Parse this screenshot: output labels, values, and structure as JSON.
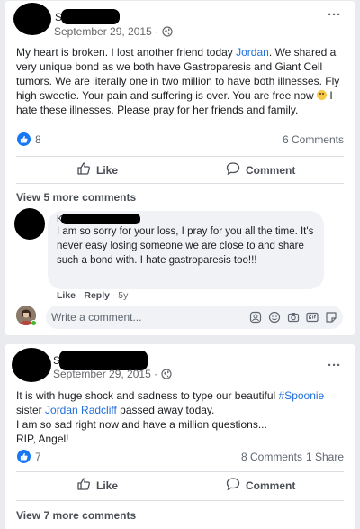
{
  "post1": {
    "author_initial": "S",
    "date": "September 29, 2015 ·",
    "text_before_mention": "My heart is broken. I lost another friend today ",
    "mention": "Jordan",
    "text_after_mention": ". We shared a very unique bond as we both have Gastroparesis and Giant Cell tumors. We are literally one in two million to have both illnesses. Fly high sweetie. Your pain and suffering is over. You are free now ",
    "text_after_emoji": "  I hate these illnesses. Please pray for her friends and family.",
    "reaction_count": "8",
    "comments_count": "6 Comments",
    "like_label": "Like",
    "comment_label": "Comment",
    "view_more": "View 5 more comments",
    "comment": {
      "author_initial": "K",
      "text": "I am so sorry for your loss, I pray for you all the time. It's never easy losing someone we are close to and share such a bond with. I hate gastroparesis too!!!",
      "like": "Like",
      "reply": "Reply",
      "age": "5y"
    },
    "write_placeholder": "Write a comment..."
  },
  "post2": {
    "author_initial": "S",
    "date": "September 29, 2015 ·",
    "text_1": "It is with huge shock and sadness to type our beautiful ",
    "hashtag": "#Spoonie",
    "text_2": " sister ",
    "mention": "Jordan Radcliff",
    "text_3": " passed away today.",
    "line_2": "I am so sad right now and have a million questions...",
    "line_3": "RIP, Angel!",
    "reaction_count": "7",
    "comments_count": "8 Comments",
    "shares_count": "1 Share",
    "like_label": "Like",
    "comment_label": "Comment",
    "view_more": "View 7 more comments"
  },
  "icons": [
    "globe-icon",
    "more-icon",
    "like-reaction-icon",
    "thumbs-up-icon",
    "comment-icon",
    "emoji-icon",
    "camera-icon",
    "gif-icon",
    "sticker-icon"
  ],
  "colors": {
    "link": "#216fdb",
    "like_blue": "#1877f2",
    "online": "#42b72a"
  }
}
